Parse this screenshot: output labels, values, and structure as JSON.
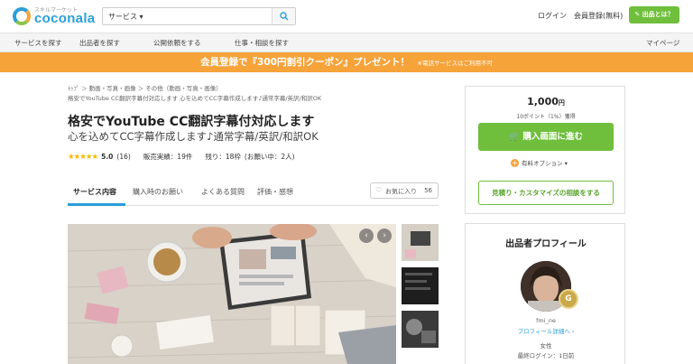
{
  "header": {
    "logo_small": "スキルマーケット",
    "logo_text": "coconala",
    "search_category": "サービス",
    "login": "ログイン",
    "signup": "会員登録(無料)",
    "sell_button": "出品とは？"
  },
  "nav": {
    "items": [
      "サービスを探す",
      "出品者を探す",
      "公開依頼をする",
      "仕事・相談を探す",
      "マイページ"
    ]
  },
  "banner": {
    "main": "会員登録で『300円割引クーポン』プレゼント！",
    "sub": "※電話サービスはご利用不可"
  },
  "breadcrumb": {
    "line1": "ﾄｯﾌﾟ ＞ 動画・写真・画像 ＞ その他（動画・写真・画像）",
    "line2": "格安でYouTube CC翻訳字幕付対応します 心を込めてCC字幕作成します♪通常字幕/英訳/和訳OK"
  },
  "service": {
    "title": "格安でYouTube CC翻訳字幕付対応します",
    "subtitle": "心を込めてCC字幕作成します♪通常字幕/英訳/和訳OK",
    "rating": "5.0",
    "reviews": "(16)",
    "sales": "販売実績：19件",
    "remaining": "残り：18枠",
    "requests": "(お願い中：2人)"
  },
  "tabs": [
    "サービス内容",
    "購入時のお願い",
    "よくある質問",
    "評価・感想"
  ],
  "favorite": {
    "label": "お気に入り",
    "count": "56"
  },
  "buybox": {
    "price": "1,000",
    "price_unit": "円",
    "points": "10ポイント（1%）獲得",
    "buy_button": "購入画面に進む",
    "option": "有料オプション",
    "consult_button": "見積り・カスタマイズの相談をする"
  },
  "profile": {
    "title": "出品者プロフィール",
    "badge": "G",
    "username": "fmi_ne",
    "link": "プロフィール詳細へ",
    "gender": "女性",
    "last_login": "最終ログイン：1日前"
  },
  "colors": {
    "accent_blue": "#2a9fd8",
    "green": "#6fbf3c",
    "orange": "#f6a33a"
  }
}
